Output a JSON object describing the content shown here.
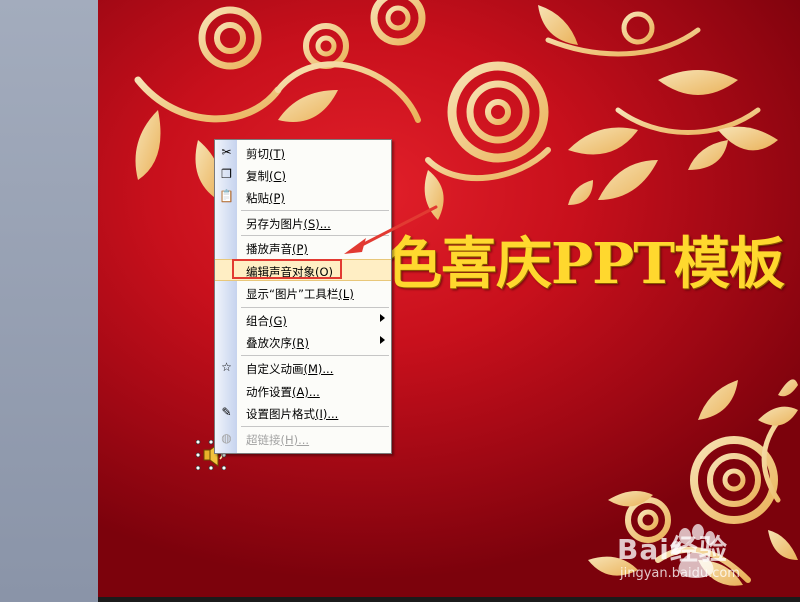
{
  "slide": {
    "title": "色喜庆PPT模板",
    "background_color": "#c8101c",
    "ornament_color": "#f4c879"
  },
  "context_menu": {
    "items": [
      {
        "label": "剪切",
        "shortcut": "(T)",
        "icon": "scissors-icon",
        "disabled": false,
        "submenu": false
      },
      {
        "label": "复制",
        "shortcut": "(C)",
        "icon": "copy-icon",
        "disabled": false,
        "submenu": false
      },
      {
        "label": "粘贴",
        "shortcut": "(P)",
        "icon": "paste-icon",
        "disabled": false,
        "submenu": false
      },
      {
        "label": "另存为图片",
        "shortcut": "(S)...",
        "icon": "",
        "disabled": false,
        "submenu": false
      },
      {
        "label": "播放声音",
        "shortcut": "(P)",
        "icon": "",
        "disabled": false,
        "submenu": false
      },
      {
        "label": "编辑声音对象",
        "shortcut": "(O)",
        "icon": "",
        "disabled": false,
        "submenu": false,
        "highlighted": true
      },
      {
        "label": "显示“图片”工具栏",
        "shortcut": "(L)",
        "icon": "",
        "disabled": false,
        "submenu": false
      },
      {
        "label": "组合",
        "shortcut": "(G)",
        "icon": "",
        "disabled": false,
        "submenu": true
      },
      {
        "label": "叠放次序",
        "shortcut": "(R)",
        "icon": "",
        "disabled": false,
        "submenu": true
      },
      {
        "label": "自定义动画",
        "shortcut": "(M)...",
        "icon": "custom-animation-icon",
        "disabled": false,
        "submenu": false
      },
      {
        "label": "动作设置",
        "shortcut": "(A)...",
        "icon": "",
        "disabled": false,
        "submenu": false
      },
      {
        "label": "设置图片格式",
        "shortcut": "(I)...",
        "icon": "format-picture-icon",
        "disabled": false,
        "submenu": false
      },
      {
        "label": "超链接",
        "shortcut": "(H)...",
        "icon": "hyperlink-icon",
        "disabled": true,
        "submenu": false
      }
    ]
  },
  "annotation": {
    "highlight_color": "#e23a32"
  },
  "watermark": {
    "brand": "Bai经验",
    "url": "jingyan.baidu.com"
  }
}
